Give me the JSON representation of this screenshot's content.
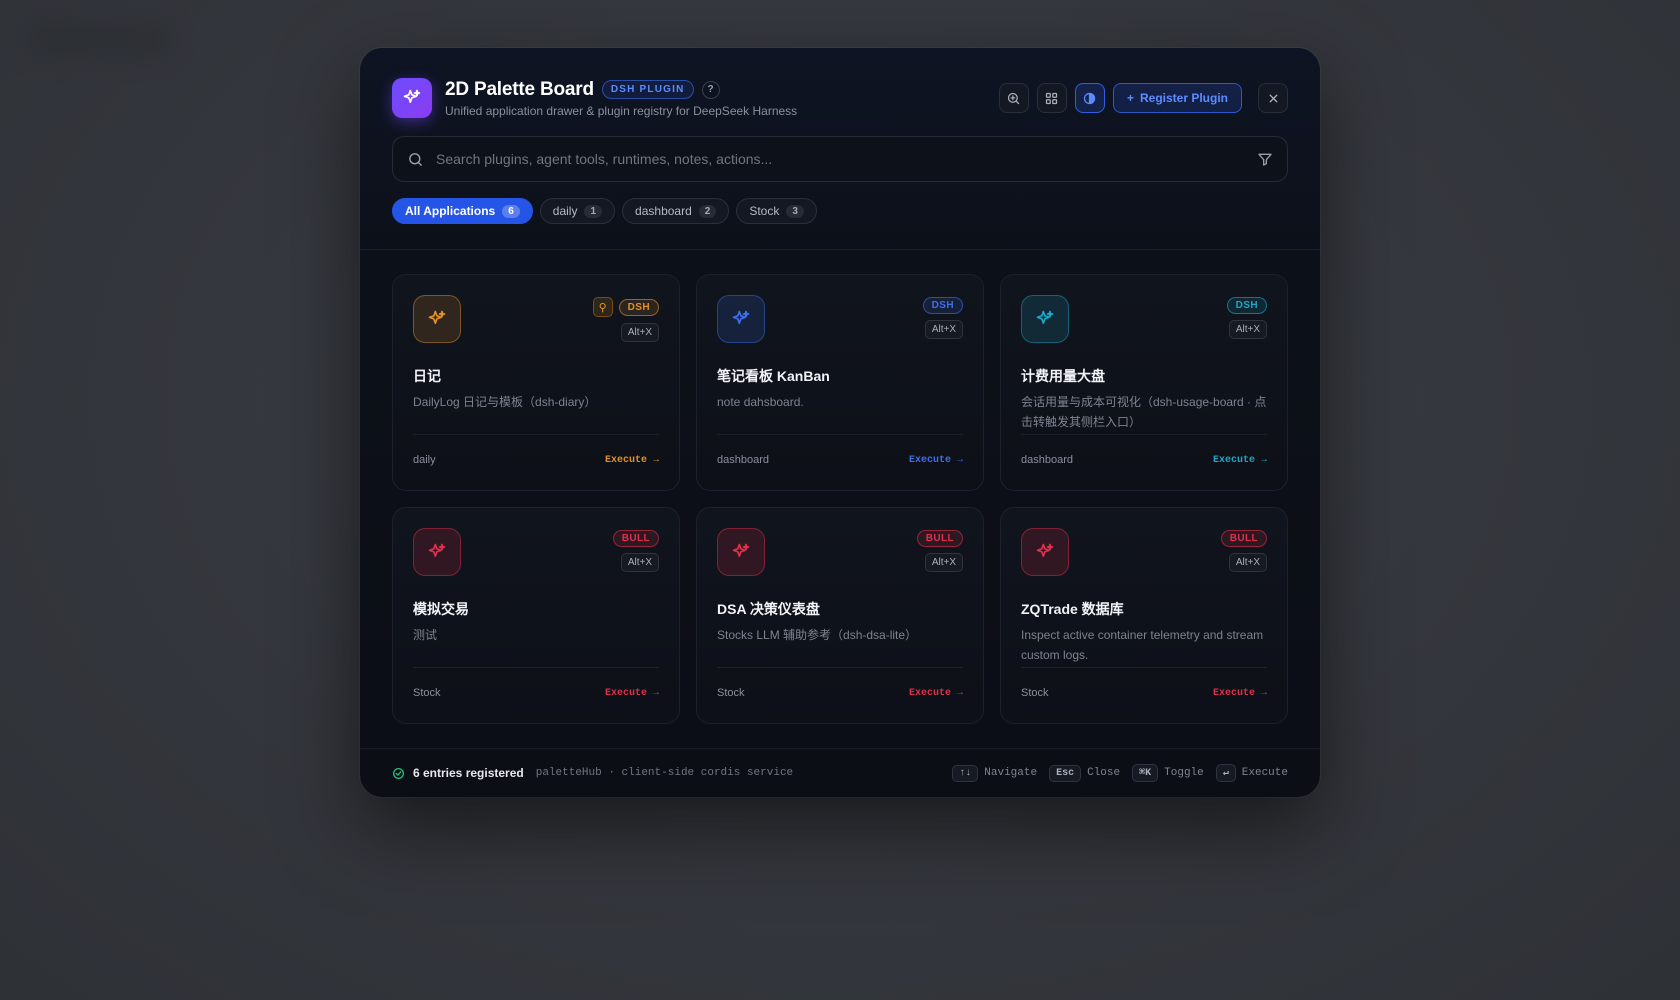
{
  "header": {
    "title": "2D Palette Board",
    "badge": "DSH PLUGIN",
    "help": "?",
    "subtitle": "Unified application drawer & plugin registry for DeepSeek Harness",
    "register_label": "Register Plugin",
    "actions": [
      "zoom-icon",
      "grid-icon",
      "contrast-icon",
      "close-icon"
    ]
  },
  "search": {
    "placeholder": "Search plugins, agent tools, runtimes, notes, actions..."
  },
  "tabs": [
    {
      "label": "All Applications",
      "count": "6",
      "active": true
    },
    {
      "label": "daily",
      "count": "1"
    },
    {
      "label": "dashboard",
      "count": "2"
    },
    {
      "label": "Stock",
      "count": "3"
    }
  ],
  "cards": [
    {
      "title": "日记",
      "desc": "DailyLog 日记与模板（dsh-diary）",
      "badge": "DSH",
      "shortcut": "Alt+X",
      "category": "daily",
      "exec": "Execute →",
      "pinned": true,
      "accent": "#e0912a"
    },
    {
      "title": "笔记看板 KanBan",
      "desc": "note dahsboard.",
      "badge": "DSH",
      "shortcut": "Alt+X",
      "category": "dashboard",
      "exec": "Execute →",
      "accent": "#3f6fe8"
    },
    {
      "title": "计费用量大盘",
      "desc": "会话用量与成本可视化（dsh-usage-board · 点击转触发其侧栏入口）",
      "badge": "DSH",
      "shortcut": "Alt+X",
      "category": "dashboard",
      "exec": "Execute →",
      "accent": "#1ea7c4"
    },
    {
      "title": "模拟交易",
      "desc": "测试",
      "badge": "BULL",
      "shortcut": "Alt+X",
      "category": "Stock",
      "exec": "Execute →",
      "accent": "#e0304a"
    },
    {
      "title": "DSA 决策仪表盘",
      "desc": "Stocks LLM 辅助参考（dsh-dsa-lite）",
      "badge": "BULL",
      "shortcut": "Alt+X",
      "category": "Stock",
      "exec": "Execute →",
      "accent": "#e0304a"
    },
    {
      "title": "ZQTrade 数据库",
      "desc": "Inspect active container telemetry and stream custom logs.",
      "badge": "BULL",
      "shortcut": "Alt+X",
      "category": "Stock",
      "exec": "Execute →",
      "accent": "#e0304a"
    }
  ],
  "footer": {
    "count": "6 entries registered",
    "service": "paletteHub · client-side cordis service",
    "hints": [
      {
        "key": "↑↓",
        "label": "Navigate"
      },
      {
        "key": "Esc",
        "label": "Close"
      },
      {
        "key": "⌘K",
        "label": "Toggle"
      },
      {
        "key": "↵",
        "label": "Execute"
      }
    ]
  }
}
